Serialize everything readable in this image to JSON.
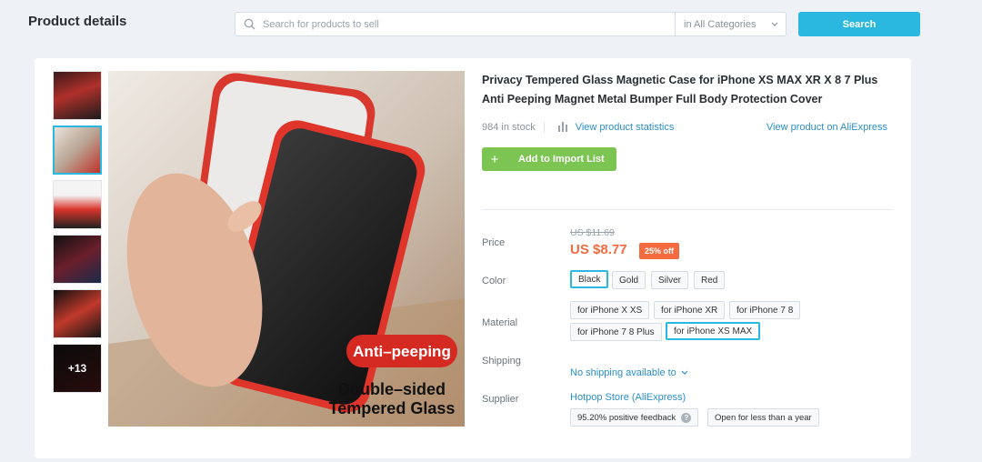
{
  "header": {
    "title": "Product details",
    "search_placeholder": "Search for products to sell",
    "category": "in All Categories",
    "search_button": "Search"
  },
  "gallery": {
    "more_count": "+13",
    "main_badge": "Anti–peeping",
    "main_caption_line1": "Double–sided",
    "main_caption_line2": "Tempered Glass"
  },
  "product": {
    "title": "Privacy Tempered Glass Magnetic Case for iPhone XS MAX XR X 8 7 Plus Anti Peeping Magnet Metal Bumper Full Body Protection Cover",
    "stock": "984 in stock",
    "stats_link": "View product statistics",
    "ali_link": "View product on AliExpress",
    "import_button": "Add to Import List",
    "price_label": "Price",
    "old_price": "US $11.69",
    "price": "US $8.77",
    "discount": "25% off",
    "color_label": "Color",
    "colors": [
      "Black",
      "Gold",
      "Silver",
      "Red"
    ],
    "selected_color": "Black",
    "material_label": "Material",
    "materials": [
      "for iPhone X XS",
      "for iPhone XR",
      "for iPhone 7 8",
      "for iPhone 7 8 Plus",
      "for iPhone XS MAX"
    ],
    "selected_material": "for iPhone XS MAX",
    "shipping_label": "Shipping",
    "shipping_value": "No shipping available to",
    "supplier_label": "Supplier",
    "supplier_name": "Hotpop Store (AliExpress)",
    "feedback": "95.20% positive feedback",
    "open_duration": "Open for less than a year"
  },
  "colors": {
    "accent": "#2bb8e0",
    "link": "#2b8ec9",
    "import_green": "#7cc552",
    "price_orange": "#f36b3f"
  }
}
